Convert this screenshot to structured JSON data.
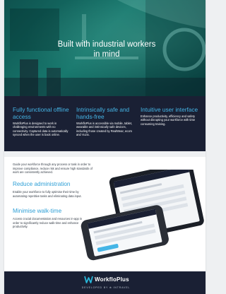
{
  "hero": {
    "title": "Built with industrial workers in mind"
  },
  "features": [
    {
      "title": "Fully functional offline access",
      "body": "WorkfloPlus is designed to work in challenging environments with no connectivity. Captured data is automatically synced when the user is back online."
    },
    {
      "title": "Intrinsically safe and hands-free",
      "body": "WorkfloPlus is accessible via mobile, tablet, wearable and intrinsically safe devices, including those created by RealWear, ecom and Vuzix."
    },
    {
      "title": "Intuitive user interface",
      "body": "Enhance productivity, efficiency and safety without disrupting your workforce with time consuming training."
    }
  ],
  "content": {
    "intro": "Guide your workforce through any process or task in order to improve compliance, reduce risk and ensure high standards of work are consistently achieved.",
    "sections": [
      {
        "title": "Reduce administration",
        "body": "Enable your workforce to fully optimise their time by automating repetitive tasks and eliminating data input."
      },
      {
        "title": "Minimise walk-time",
        "body": "Access crucial documentation and resources in-app in order to significantly reduce walk-time and enhance productivity."
      }
    ]
  },
  "footer": {
    "logo_text": "WorkfloPlus",
    "developed_by": "DEVELOPED BY ⊕ INTRAVEL"
  },
  "colors": {
    "navy": "#1a2034",
    "accent_blue": "#45b5e6",
    "hero_teal": "#1c8c7e",
    "logo_cyan": "#29b6d8"
  }
}
